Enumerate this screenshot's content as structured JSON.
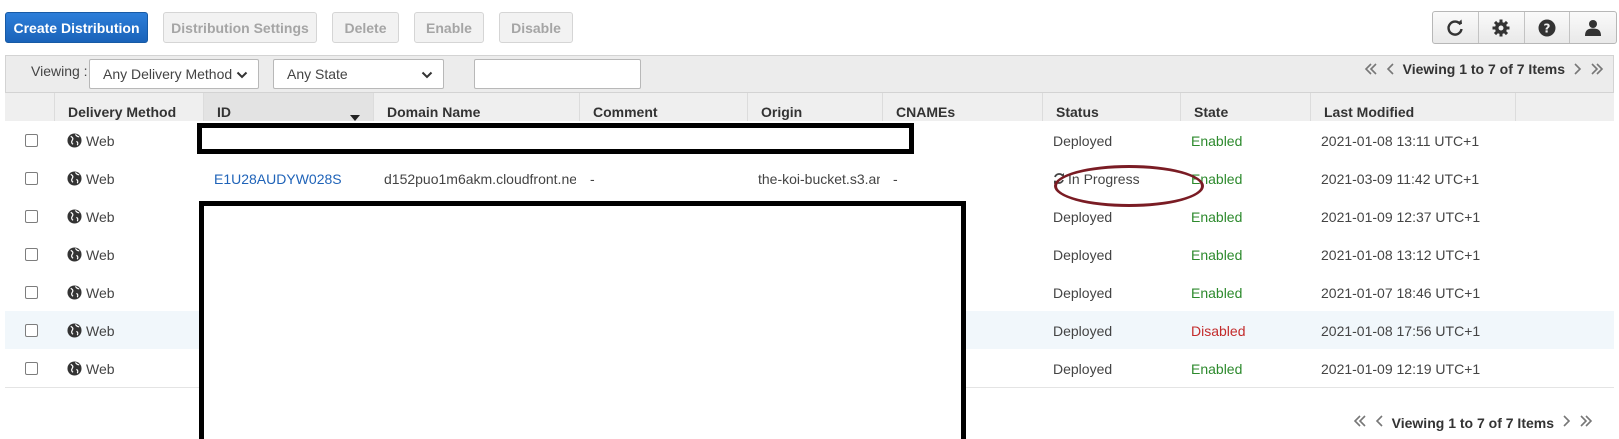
{
  "toolbar": {
    "create": "Create Distribution",
    "settings": "Distribution Settings",
    "delete": "Delete",
    "enable": "Enable",
    "disable": "Disable",
    "icons": [
      "refresh-icon",
      "gear-icon",
      "help-icon",
      "user-icon"
    ]
  },
  "filters": {
    "viewing_label": "Viewing :",
    "delivery_method": "Any Delivery Method",
    "state": "Any State",
    "search_value": ""
  },
  "pagination": {
    "text": "Viewing 1 to 7 of 7 Items"
  },
  "columns": [
    "Delivery Method",
    "ID",
    "Domain Name",
    "Comment",
    "Origin",
    "CNAMEs",
    "Status",
    "State",
    "Last Modified"
  ],
  "rows": [
    {
      "method": "Web",
      "id": "",
      "domain": "",
      "comment": "",
      "origin": "",
      "cnames": "",
      "status": "Deployed",
      "state": "Enabled",
      "modified": "2021-01-08 13:11 UTC+1"
    },
    {
      "method": "Web",
      "id": "E1U28AUDYW028S",
      "domain": "d152puo1m6akm.cloudfront.ne",
      "comment": "-",
      "origin": "the-koi-bucket.s3.an",
      "cnames": "-",
      "status": "In Progress",
      "state": "Enabled",
      "modified": "2021-03-09 11:42 UTC+1"
    },
    {
      "method": "Web",
      "id": "",
      "domain": "",
      "comment": "",
      "origin": "",
      "cnames": "",
      "status": "Deployed",
      "state": "Enabled",
      "modified": "2021-01-09 12:37 UTC+1"
    },
    {
      "method": "Web",
      "id": "",
      "domain": "",
      "comment": "",
      "origin": "",
      "cnames": "",
      "status": "Deployed",
      "state": "Enabled",
      "modified": "2021-01-08 13:12 UTC+1"
    },
    {
      "method": "Web",
      "id": "",
      "domain": "",
      "comment": "",
      "origin": "",
      "cnames": "",
      "status": "Deployed",
      "state": "Enabled",
      "modified": "2021-01-07 18:46 UTC+1"
    },
    {
      "method": "Web",
      "id": "",
      "domain": "",
      "comment": "",
      "origin": "",
      "cnames": "",
      "status": "Deployed",
      "state": "Disabled",
      "modified": "2021-01-08 17:56 UTC+1"
    },
    {
      "method": "Web",
      "id": "",
      "domain": "",
      "comment": "",
      "origin": "",
      "cnames": "",
      "status": "Deployed",
      "state": "Enabled",
      "modified": "2021-01-09 12:19 UTC+1"
    }
  ],
  "colors": {
    "primary": "#1a63b9",
    "link": "#1f63b8",
    "enabled": "#2d8a2d",
    "disabled": "#c32b2b",
    "annotation": "#7a1c24"
  }
}
